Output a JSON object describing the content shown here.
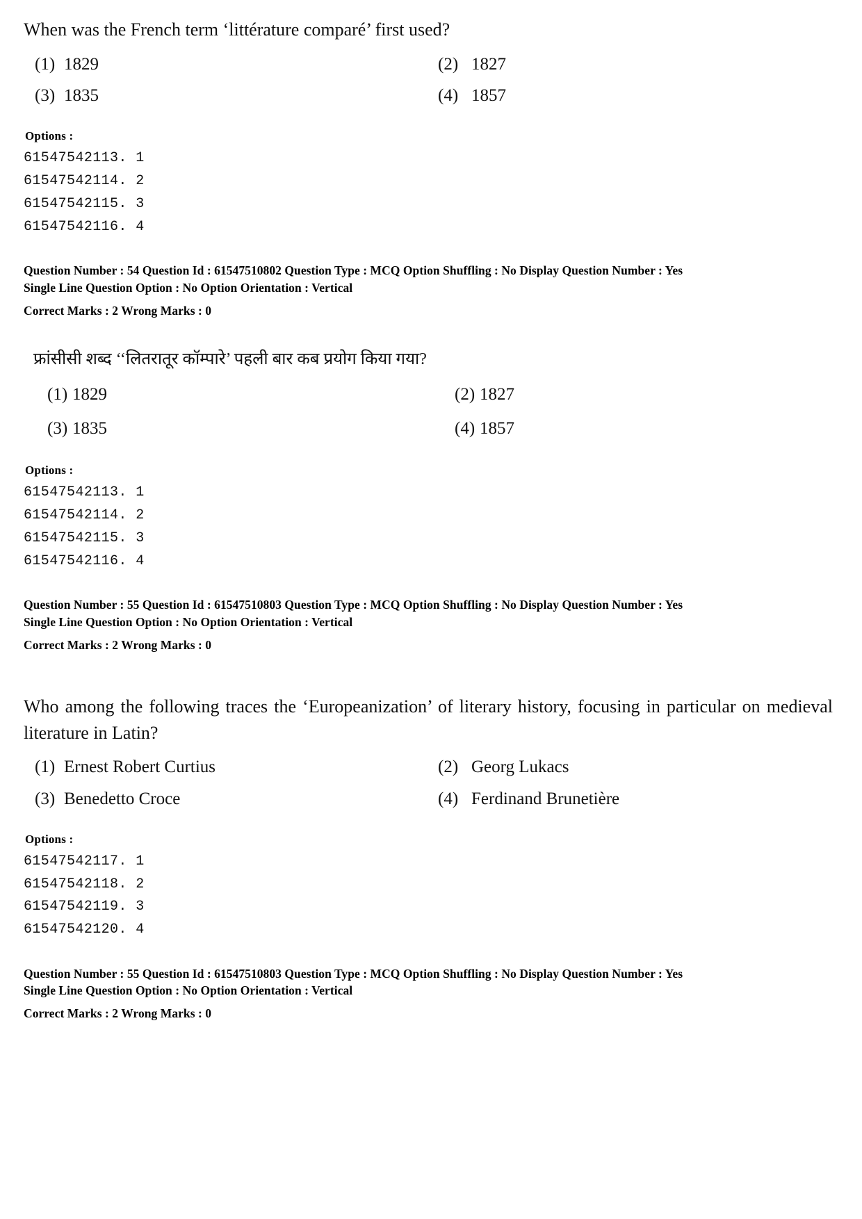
{
  "questions": [
    {
      "id": "q54-en",
      "language": "en",
      "text": "When was the French term ‘littérature comparé’ first used?",
      "choices": [
        {
          "num": "(1)",
          "value": "1829"
        },
        {
          "num": "(2)",
          "value": "1827"
        },
        {
          "num": "(3)",
          "value": "1835"
        },
        {
          "num": "(4)",
          "value": "1857"
        }
      ],
      "options_label": "Options :",
      "option_ids": [
        "61547542113. 1",
        "61547542114. 2",
        "61547542115. 3",
        "61547542116. 4"
      ],
      "meta": {
        "line1": "Question Number : 54  Question Id : 61547510802  Question Type : MCQ  Option Shuffling : No  Display Question Number : Yes",
        "line2": "Single Line Question Option : No  Option Orientation : Vertical",
        "line3": "Correct Marks : 2  Wrong Marks : 0"
      }
    },
    {
      "id": "q54-hi",
      "language": "hi",
      "text": "फ्रांसीसी शब्द ‘‘लितरातूर कॉम्पारे’ पहली बार कब प्रयोग किया गया?",
      "choices": [
        {
          "num": "(1)",
          "value": "1829"
        },
        {
          "num": "(2)",
          "value": "1827"
        },
        {
          "num": "(3)",
          "value": "1835"
        },
        {
          "num": "(4)",
          "value": "1857"
        }
      ],
      "options_label": "Options :",
      "option_ids": [
        "61547542113. 1",
        "61547542114. 2",
        "61547542115. 3",
        "61547542116. 4"
      ],
      "meta": {
        "line1": "Question Number : 55  Question Id : 61547510803  Question Type : MCQ  Option Shuffling : No  Display Question Number : Yes",
        "line2": "Single Line Question Option : No  Option Orientation : Vertical",
        "line3": "Correct Marks : 2  Wrong Marks : 0"
      }
    },
    {
      "id": "q55-en",
      "language": "en",
      "text": "Who among the following traces the ‘Europeanization’ of literary history, focusing in particular on medieval literature in Latin?",
      "choices": [
        {
          "num": "(1)",
          "value": "Ernest Robert Curtius"
        },
        {
          "num": "(2)",
          "value": "Georg Lukacs"
        },
        {
          "num": "(3)",
          "value": "Benedetto Croce"
        },
        {
          "num": "(4)",
          "value": "Ferdinand Brunetière"
        }
      ],
      "options_label": "Options :",
      "option_ids": [
        "61547542117. 1",
        "61547542118. 2",
        "61547542119. 3",
        "61547542120. 4"
      ],
      "meta": {
        "line1": "Question Number : 55  Question Id : 61547510803  Question Type : MCQ  Option Shuffling : No  Display Question Number : Yes",
        "line2": "Single Line Question Option : No  Option Orientation : Vertical",
        "line3": "Correct Marks : 2  Wrong Marks : 0"
      }
    }
  ]
}
